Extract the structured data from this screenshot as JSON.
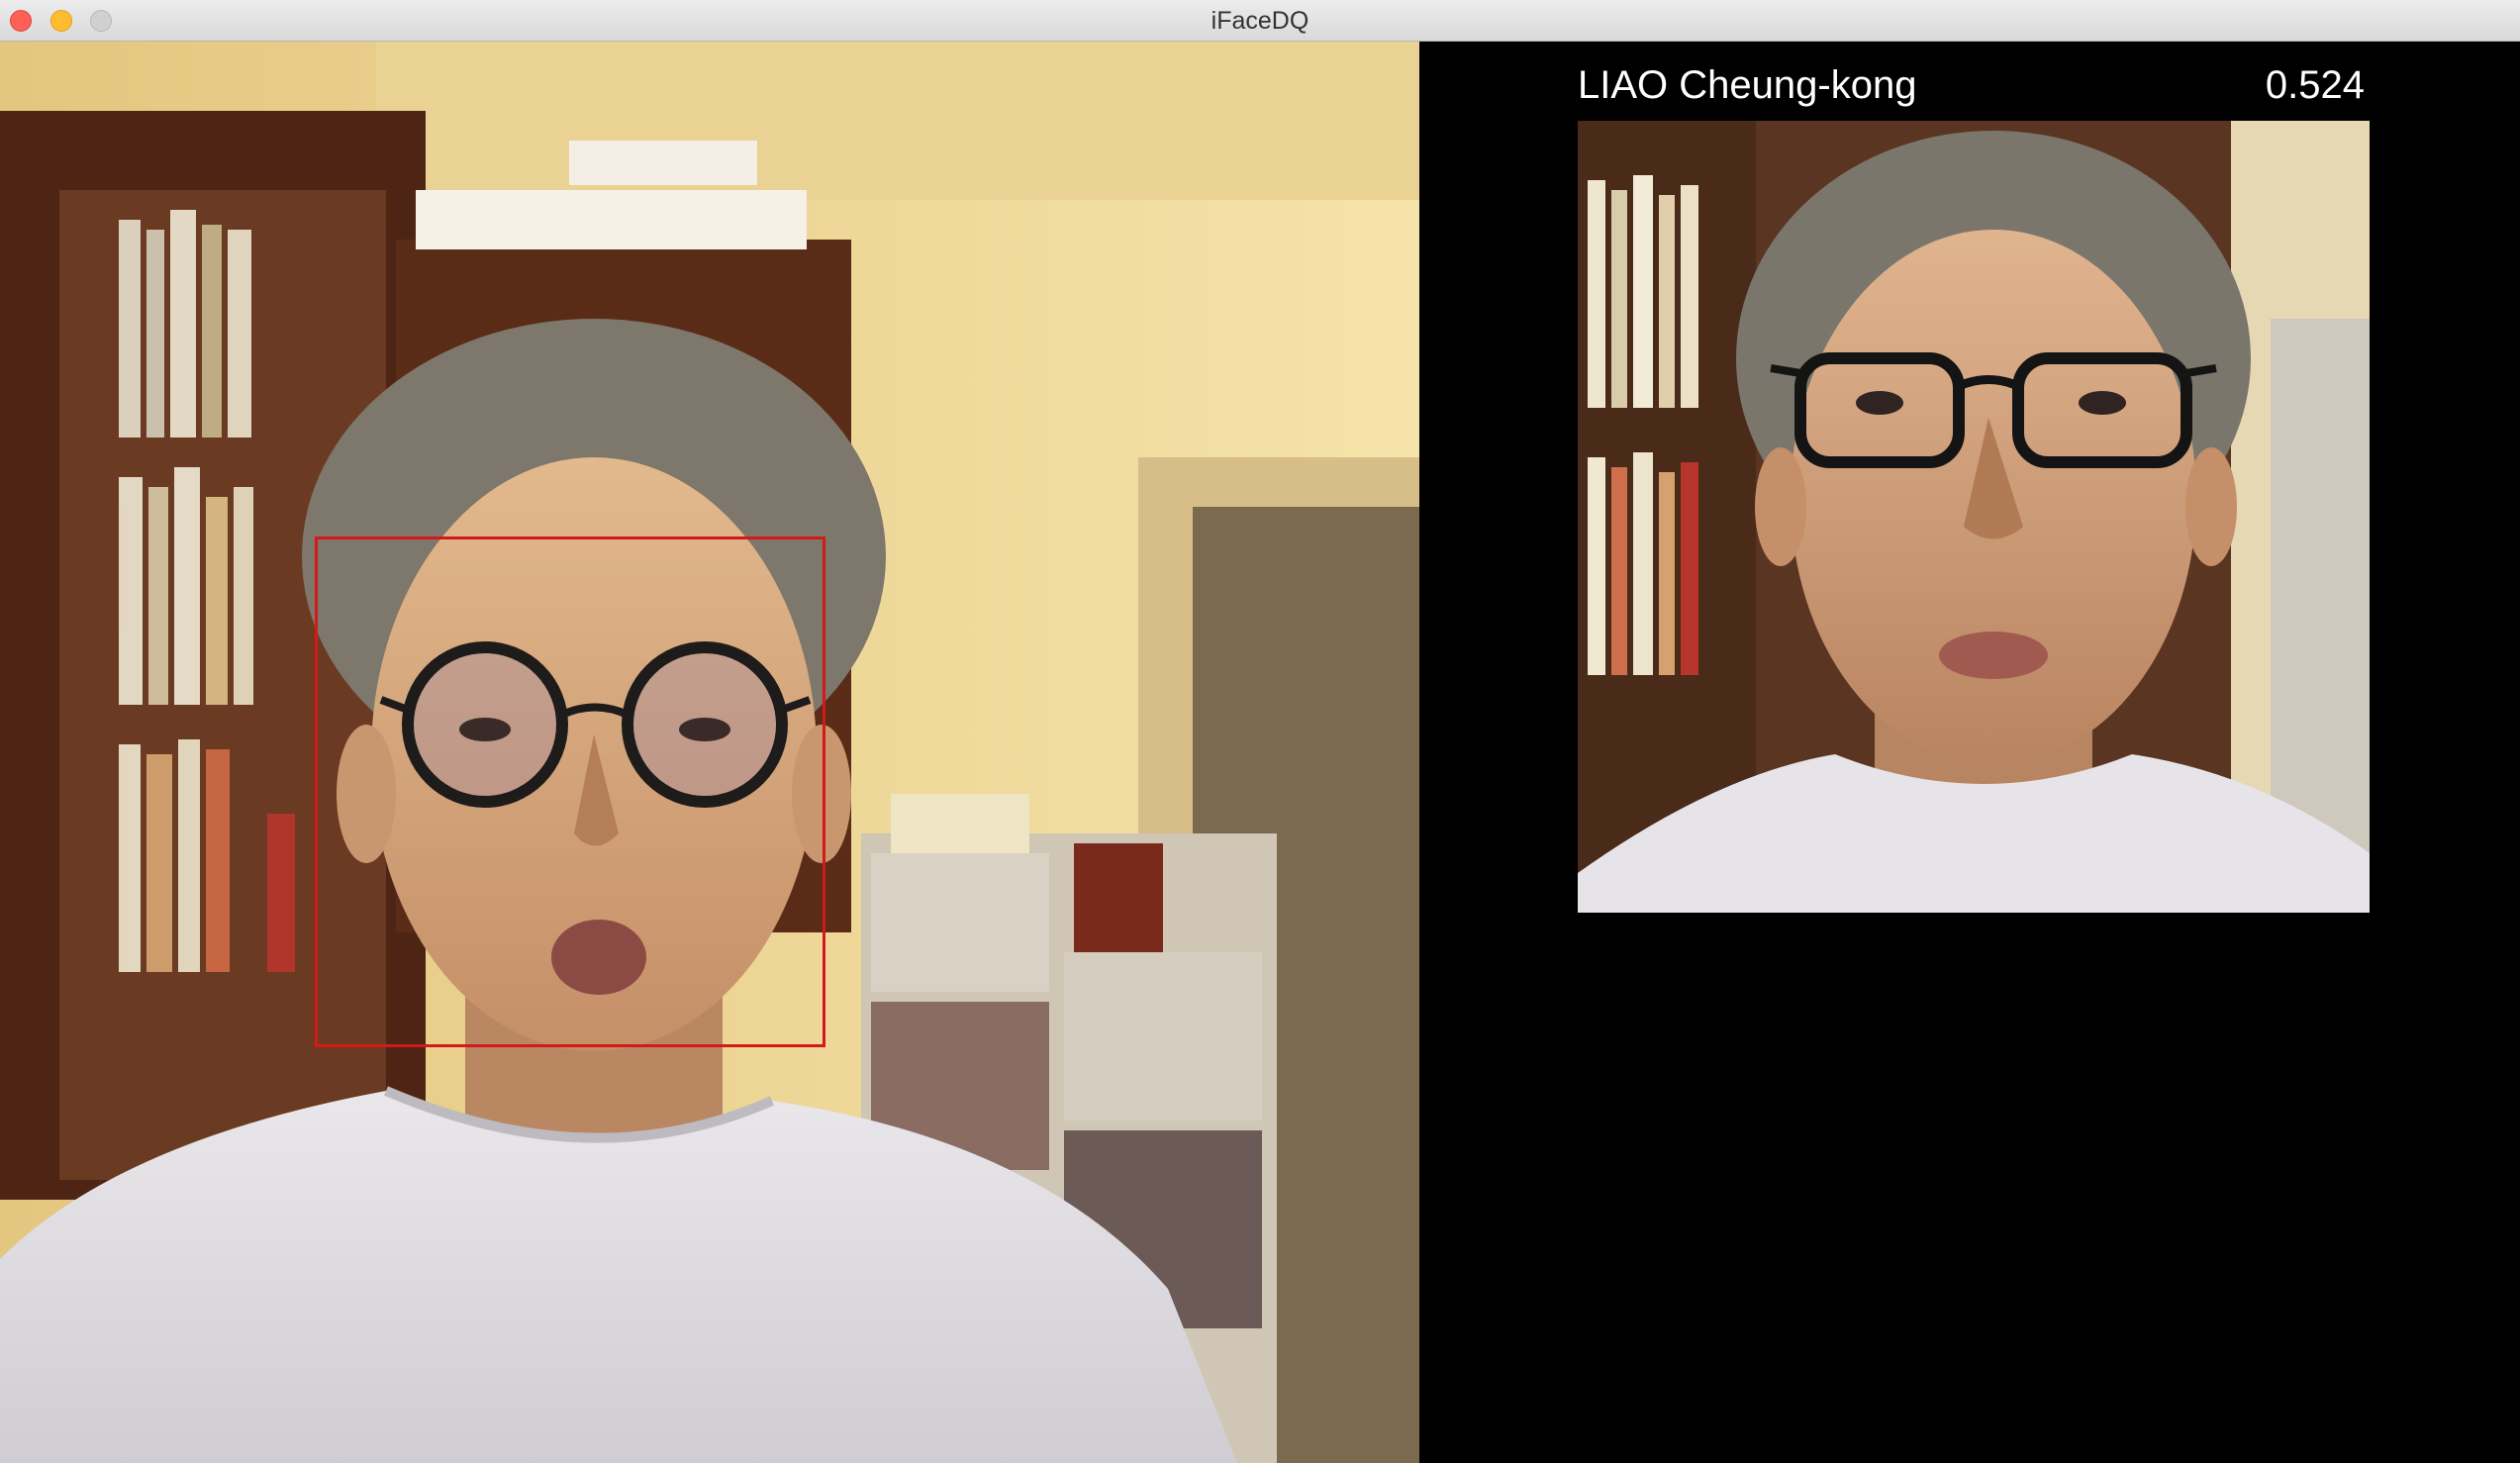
{
  "window": {
    "title": "iFaceDQ"
  },
  "camera": {
    "description_icon": "camera-feed",
    "detection_box_color": "#d21a1a"
  },
  "match": {
    "name": "LIAO Cheung-kong",
    "score": "0.524"
  },
  "colors": {
    "panel_background": "#000000",
    "text": "#ffffff",
    "traffic_close": "#fe5f57",
    "traffic_minimize": "#febc2e",
    "traffic_zoom": "#d0d0d0"
  }
}
